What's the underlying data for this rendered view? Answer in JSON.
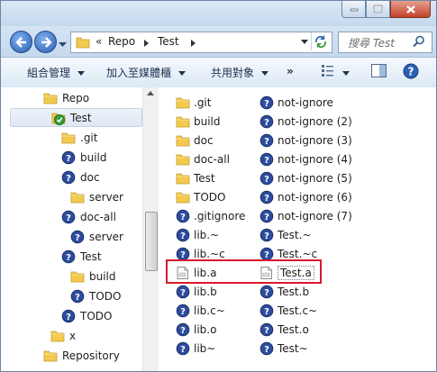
{
  "address": {
    "overflow": "«",
    "crumbs": [
      "Repo",
      "Test"
    ]
  },
  "search": {
    "placeholder": "搜尋 Test"
  },
  "toolbar": {
    "organize": "組合管理",
    "add_to_library": "加入至媒體櫃",
    "share_with": "共用對象",
    "more": "»"
  },
  "colors": {
    "folder": "#f3c94e",
    "help_icon": "#2c4c9f",
    "highlight": "#d9182d",
    "check": "#3aa03a"
  },
  "sidebar": {
    "items": [
      {
        "label": "Repo",
        "icon": "folder-icon",
        "level": 1
      },
      {
        "label": "Test",
        "icon": "folder-check-icon",
        "level": 2,
        "selected": true
      },
      {
        "label": ".git",
        "icon": "folder-icon",
        "level": 3
      },
      {
        "label": "build",
        "icon": "unknown-file-icon",
        "level": 3
      },
      {
        "label": "doc",
        "icon": "unknown-file-icon",
        "level": 3
      },
      {
        "label": "server",
        "icon": "folder-icon",
        "level": 4
      },
      {
        "label": "doc-all",
        "icon": "unknown-file-icon",
        "level": 3
      },
      {
        "label": "server",
        "icon": "unknown-file-icon",
        "level": 4
      },
      {
        "label": "Test",
        "icon": "unknown-file-icon",
        "level": 3
      },
      {
        "label": "build",
        "icon": "folder-icon",
        "level": 4
      },
      {
        "label": "TODO",
        "icon": "unknown-file-icon",
        "level": 4
      },
      {
        "label": "TODO",
        "icon": "unknown-file-icon",
        "level": 3
      },
      {
        "label": "x",
        "icon": "folder-icon",
        "level": 2
      },
      {
        "label": "Repository",
        "icon": "folder-icon",
        "level": 1
      }
    ]
  },
  "files": {
    "col1": [
      {
        "label": ".git",
        "icon": "folder-icon"
      },
      {
        "label": "build",
        "icon": "folder-icon"
      },
      {
        "label": "doc",
        "icon": "folder-icon"
      },
      {
        "label": "doc-all",
        "icon": "folder-icon"
      },
      {
        "label": "Test",
        "icon": "folder-icon"
      },
      {
        "label": "TODO",
        "icon": "folder-icon"
      },
      {
        "label": ".gitignore",
        "icon": "unknown-file-icon"
      },
      {
        "label": "lib.~",
        "icon": "unknown-file-icon"
      },
      {
        "label": "lib.~c",
        "icon": "unknown-file-icon"
      },
      {
        "label": "lib.a",
        "icon": "generic-file-icon"
      },
      {
        "label": "lib.b",
        "icon": "unknown-file-icon"
      },
      {
        "label": "lib.c~",
        "icon": "unknown-file-icon"
      },
      {
        "label": "lib.o",
        "icon": "unknown-file-icon"
      },
      {
        "label": "lib~",
        "icon": "unknown-file-icon"
      }
    ],
    "col2": [
      {
        "label": "not-ignore",
        "icon": "unknown-file-icon"
      },
      {
        "label": "not-ignore (2)",
        "icon": "unknown-file-icon"
      },
      {
        "label": "not-ignore (3)",
        "icon": "unknown-file-icon"
      },
      {
        "label": "not-ignore (4)",
        "icon": "unknown-file-icon"
      },
      {
        "label": "not-ignore (5)",
        "icon": "unknown-file-icon"
      },
      {
        "label": "not-ignore (6)",
        "icon": "unknown-file-icon"
      },
      {
        "label": "not-ignore (7)",
        "icon": "unknown-file-icon"
      },
      {
        "label": "Test.~",
        "icon": "unknown-file-icon"
      },
      {
        "label": "Test.~c",
        "icon": "unknown-file-icon"
      },
      {
        "label": "Test.a",
        "icon": "generic-file-icon",
        "focused": true
      },
      {
        "label": "Test.b",
        "icon": "unknown-file-icon"
      },
      {
        "label": "Test.c~",
        "icon": "unknown-file-icon"
      },
      {
        "label": "Test.o",
        "icon": "unknown-file-icon"
      },
      {
        "label": "Test~",
        "icon": "unknown-file-icon"
      }
    ]
  }
}
